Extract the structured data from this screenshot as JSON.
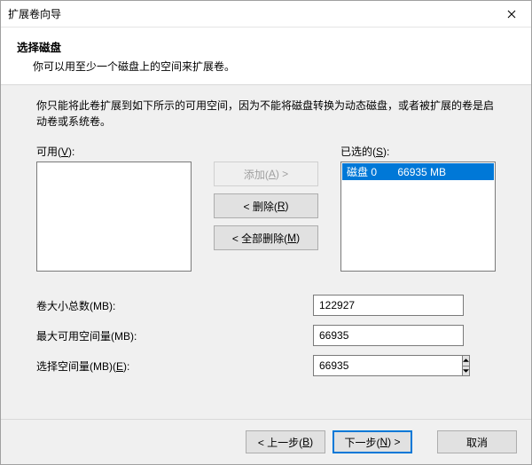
{
  "window": {
    "title": "扩展卷向导"
  },
  "header": {
    "heading": "选择磁盘",
    "subheading": "你可以用至少一个磁盘上的空间来扩展卷。"
  },
  "body": {
    "instruction": "你只能将此卷扩展到如下所示的可用空间，因为不能将磁盘转换为动态磁盘，或者被扩展的卷是启动卷或系统卷。",
    "available_label_pre": "可用(",
    "available_label_key": "V",
    "available_label_post": "):",
    "selected_label_pre": "已选的(",
    "selected_label_key": "S",
    "selected_label_post": "):",
    "available_items": [],
    "selected_items": [
      {
        "label": "磁盘 0       66935 MB",
        "selected": true
      }
    ],
    "buttons": {
      "add_pre": "添加(",
      "add_key": "A",
      "add_post": ") >",
      "remove_pre": "< 删除(",
      "remove_key": "R",
      "remove_post": ")",
      "remove_all_pre": "< 全部删除(",
      "remove_all_key": "M",
      "remove_all_post": ")"
    },
    "field_total_label": "卷大小总数(MB):",
    "field_total_value": "122927",
    "field_max_label": "最大可用空间量(MB):",
    "field_max_value": "66935",
    "field_select_label_pre": "选择空间量(MB)(",
    "field_select_label_key": "E",
    "field_select_label_post": "):",
    "field_select_value": "66935"
  },
  "footer": {
    "back_pre": "< 上一步(",
    "back_key": "B",
    "back_post": ")",
    "next_pre": "下一步(",
    "next_key": "N",
    "next_post": ") >",
    "cancel": "取消"
  }
}
